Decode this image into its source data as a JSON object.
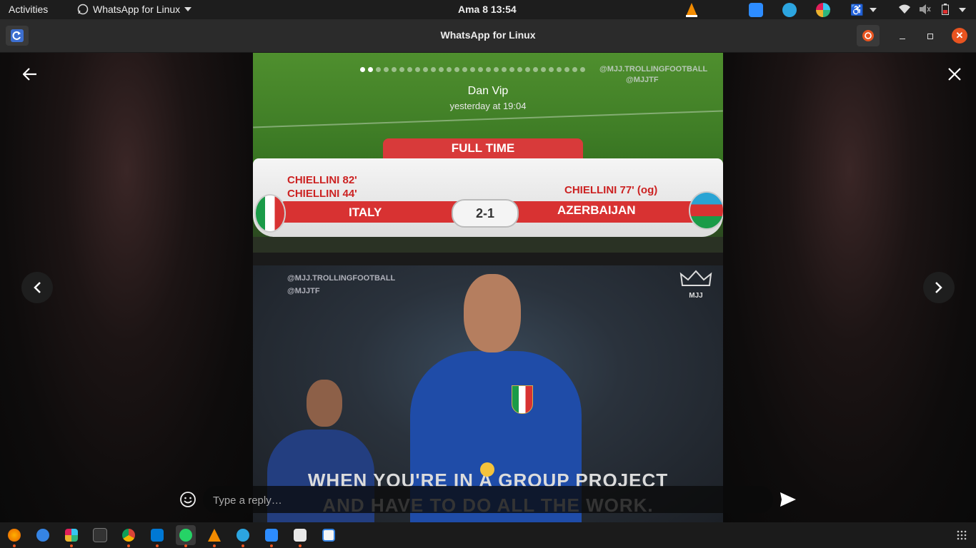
{
  "topbar": {
    "activities": "Activities",
    "app_name": "WhatsApp for Linux",
    "clock": "Ama 8  13:54"
  },
  "window": {
    "title": "WhatsApp for Linux"
  },
  "story": {
    "sender": "Dan Vip",
    "timestamp": "yesterday at 19:04",
    "segments_total": 29,
    "segment_active": 2,
    "scoreboard": {
      "header": "FULL TIME",
      "home_scorers": [
        "CHIELLINI 82'",
        "CHIELLINI 44'"
      ],
      "away_scorers": "CHIELLINI 77'  (og)",
      "home_team": "ITALY",
      "away_team": "AZERBAIJAN",
      "score": "2-1"
    },
    "watermark_handle": "@MJJ.TROLLINGFOOTBALL",
    "watermark_twitter": "@MJJTF",
    "logo_text": "MJJ",
    "meme_line1": "WHEN YOU'RE IN A GROUP PROJECT",
    "meme_line2": "AND HAVE TO DO ALL THE WORK."
  },
  "reply": {
    "placeholder": "Type a reply…"
  },
  "icons": {
    "back": "arrow-left",
    "close": "x",
    "prev": "chevron-left",
    "next": "chevron-right",
    "emoji": "smiley",
    "send": "paper-plane"
  },
  "colors": {
    "accent": "#e95420",
    "scoreboard_red": "#d83232"
  }
}
